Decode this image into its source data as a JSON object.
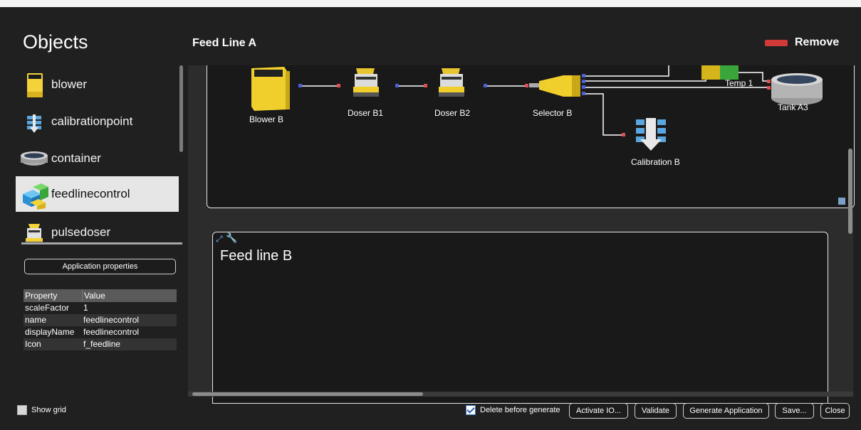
{
  "left_panel": {
    "title": "Objects",
    "items": [
      {
        "label": "blower",
        "icon": "blower-icon"
      },
      {
        "label": "calibrationpoint",
        "icon": "calibration-icon"
      },
      {
        "label": "container",
        "icon": "container-icon"
      },
      {
        "label": "feedlinecontrol",
        "icon": "feedline-icon",
        "selected": true
      },
      {
        "label": "pulsedoser",
        "icon": "pulsedoser-icon"
      }
    ],
    "app_properties_label": "Application properties",
    "properties": {
      "headers": [
        "Property",
        "Value"
      ],
      "rows": [
        {
          "property": "scaleFactor",
          "value": "1"
        },
        {
          "property": "name",
          "value": "feedlinecontrol"
        },
        {
          "property": "displayName",
          "value": "feedlinecontrol"
        },
        {
          "property": "Icon",
          "value": "f_feedline"
        }
      ]
    },
    "show_grid_label": "Show grid"
  },
  "header": {
    "feed_line_title": "Feed Line A",
    "remove_label": "Remove"
  },
  "diagram": {
    "nodes": {
      "blower": "Blower B",
      "doser1": "Doser B1",
      "doser2": "Doser B2",
      "selector": "Selector B",
      "temp": "Temp 1",
      "tank": "Tank A3",
      "calibration": "Calibration B"
    },
    "feed_line_b_title": "Feed line B"
  },
  "footer": {
    "delete_before_generate": "Delete before generate",
    "activate_io": "Activate IO...",
    "validate": "Validate",
    "generate": "Generate Application",
    "save": "Save...",
    "close": "Close"
  },
  "colors": {
    "background": "#202020",
    "accent_red": "#d23a3a",
    "yellow": "#f2cf2a"
  }
}
